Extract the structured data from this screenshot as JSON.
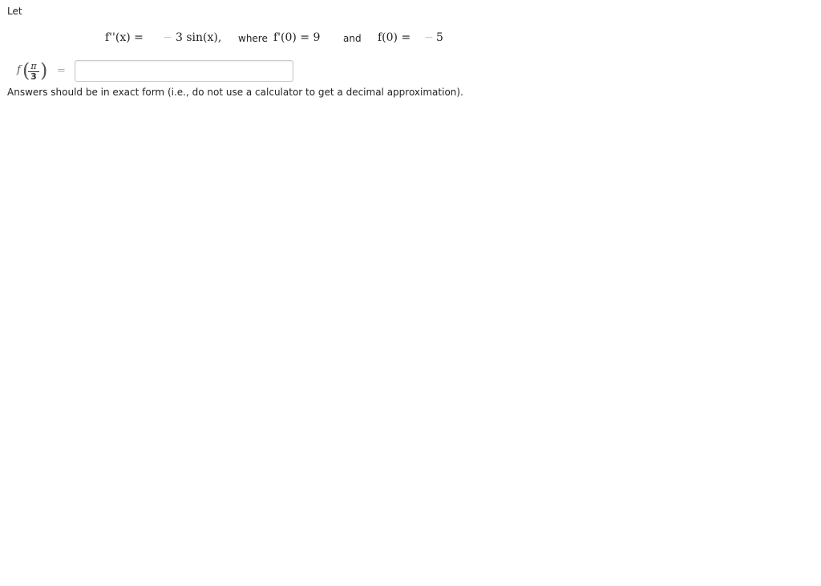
{
  "intro": "Let",
  "equation": {
    "lhs": "f''(x) =",
    "minus1": "−",
    "rhs": "3 sin(x),",
    "where_word": "where",
    "cond1": "f'(0) = 9",
    "and_word": "and",
    "cond2_lhs": "f(0) =",
    "minus2": "−",
    "cond2_rhs": "5"
  },
  "answer": {
    "func": "f",
    "numerator": "π",
    "denominator": "3",
    "equals": "=",
    "value": "",
    "placeholder": ""
  },
  "note": "Answers should be in exact form (i.e., do not use a calculator to get a decimal approximation)."
}
